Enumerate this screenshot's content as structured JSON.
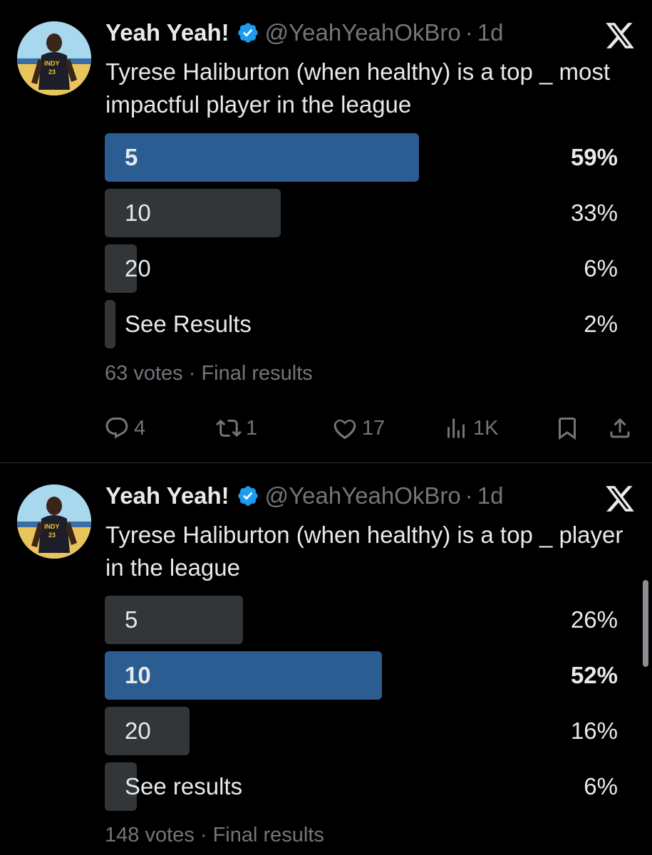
{
  "colors": {
    "background": "#000000",
    "text": "#e7e9ea",
    "muted": "#71767b",
    "bar": "#333639",
    "winning_bar": "#2b5d92",
    "verified": "#1d9bf0"
  },
  "tweets": [
    {
      "author": {
        "display_name": "Yeah Yeah!",
        "handle": "@YeahYeahOkBro",
        "separator": "·",
        "time": "1d",
        "avatar_icon": "avatar-icon",
        "badge_icon": "verified-badge-icon"
      },
      "platform_icon": "x-logo-icon",
      "text": "Tyrese Haliburton (when healthy) is a top _ most impactful player in the league",
      "poll": {
        "options": [
          {
            "label": "5",
            "percent": "59%",
            "fill": 0.61,
            "winner": true
          },
          {
            "label": "10",
            "percent": "33%",
            "fill": 0.34,
            "winner": false
          },
          {
            "label": "20",
            "percent": "6%",
            "fill": 0.063,
            "winner": false
          },
          {
            "label": "See Results",
            "percent": "2%",
            "fill": 0.021,
            "winner": false
          }
        ],
        "votes": "63 votes",
        "separator": "·",
        "status": "Final results"
      },
      "actions": {
        "reply_count": "4",
        "repost_count": "1",
        "like_count": "17",
        "views_count": "1K",
        "icons": [
          "reply-icon",
          "repost-icon",
          "like-icon",
          "views-icon",
          "bookmark-icon",
          "share-icon"
        ]
      }
    },
    {
      "author": {
        "display_name": "Yeah Yeah!",
        "handle": "@YeahYeahOkBro",
        "separator": "·",
        "time": "1d",
        "avatar_icon": "avatar-icon",
        "badge_icon": "verified-badge-icon"
      },
      "platform_icon": "x-logo-icon",
      "text": "Tyrese Haliburton (when healthy) is a top _ player in the league",
      "poll": {
        "options": [
          {
            "label": "5",
            "percent": "26%",
            "fill": 0.27,
            "winner": false
          },
          {
            "label": "10",
            "percent": "52%",
            "fill": 0.54,
            "winner": true
          },
          {
            "label": "20",
            "percent": "16%",
            "fill": 0.165,
            "winner": false
          },
          {
            "label": "See results",
            "percent": "6%",
            "fill": 0.063,
            "winner": false
          }
        ],
        "votes": "148 votes",
        "separator": "·",
        "status": "Final results"
      }
    }
  ]
}
